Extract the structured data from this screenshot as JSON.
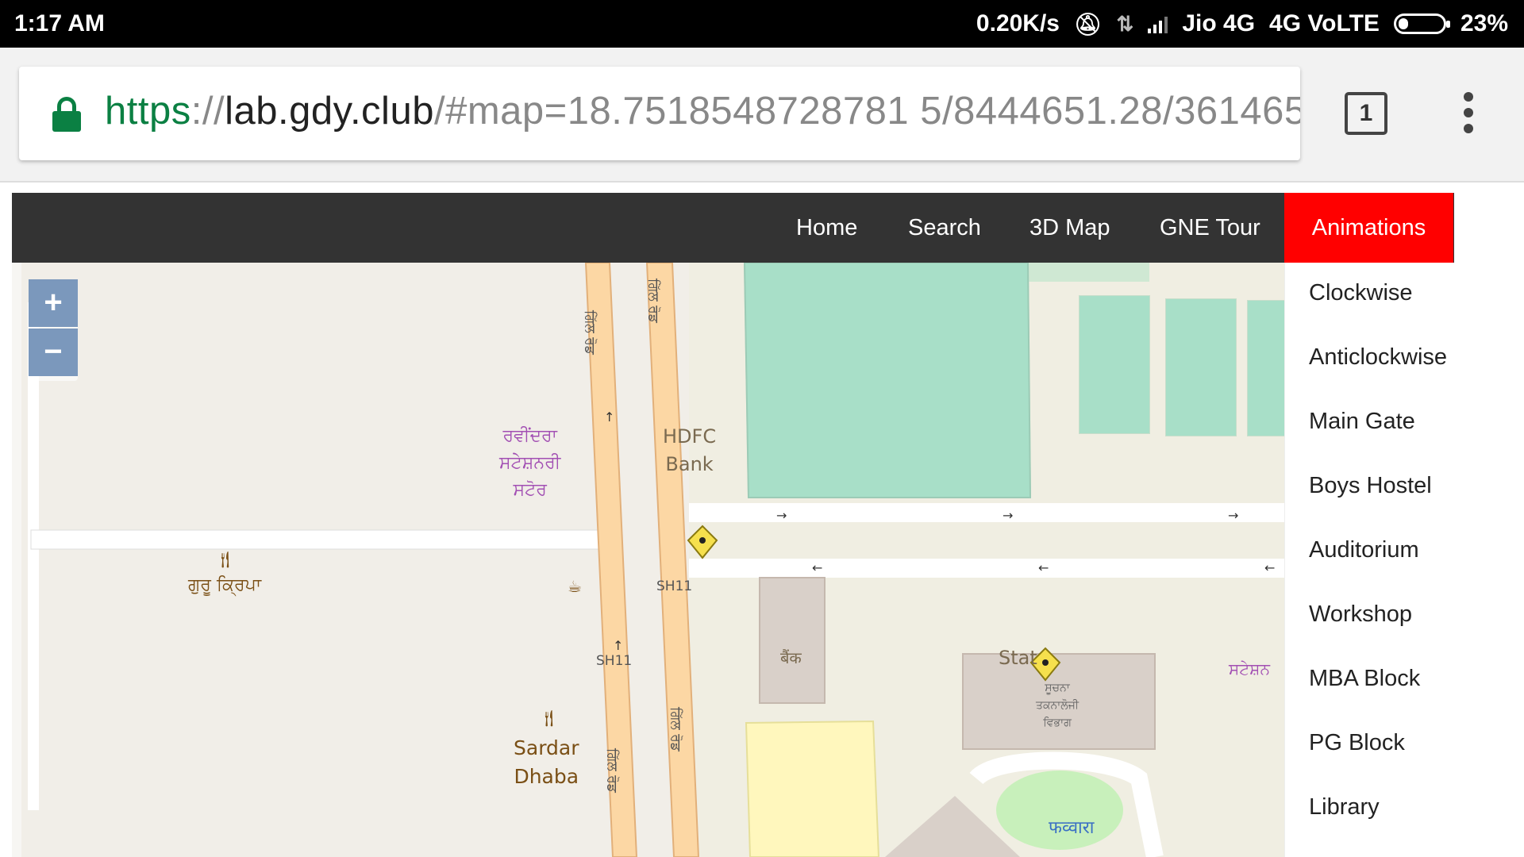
{
  "status_bar": {
    "time": "1:17 AM",
    "speed": "0.20K/s",
    "carrier": "Jio 4G",
    "network": "4G VoLTE",
    "battery": "23%",
    "battery_level": 0.23
  },
  "browser": {
    "url_scheme": "https",
    "url_sep": "://",
    "url_host": "lab.gdy.club",
    "url_path": "/#map=18.7518548728781 5/8444651.28/361465",
    "tab_count": "1"
  },
  "navbar": {
    "items": [
      "Home",
      "Search",
      "3D Map",
      "GNE Tour",
      "Animations"
    ],
    "active": "Animations"
  },
  "dropdown": {
    "items": [
      "Clockwise",
      "Anticlockwise",
      "Main Gate",
      "Boys Hostel",
      "Auditorium",
      "Workshop",
      "MBA Block",
      "PG Block",
      "Library"
    ]
  },
  "map": {
    "zoom_in": "+",
    "zoom_out": "−",
    "labels": {
      "stationery": "ਰਵੀਂਦਰਾ\nਸਟੇਸ਼ਨਰੀ\nਸਟੋਰ",
      "guru_kripa": "ਗੁਰੂ ਕ੍ਰਿਪਾ",
      "hdfc": "HDFC\nBank",
      "sardar_dhaba": "Sardar\nDhaba",
      "sh11_a": "SH11",
      "sh11_b": "SH11",
      "gill_road": "ਗਿੱਲ ਰੋਡ",
      "bank_hi": "बैंक",
      "stat": "Stat",
      "it_dept": "ਸੂਚਨਾ\nਤਕਨਾਲੋਜੀ\nਵਿਭਾਗ",
      "fountain": "फव्वारा",
      "stationery2": "ਸਟੇਸ਼ਨ"
    }
  }
}
